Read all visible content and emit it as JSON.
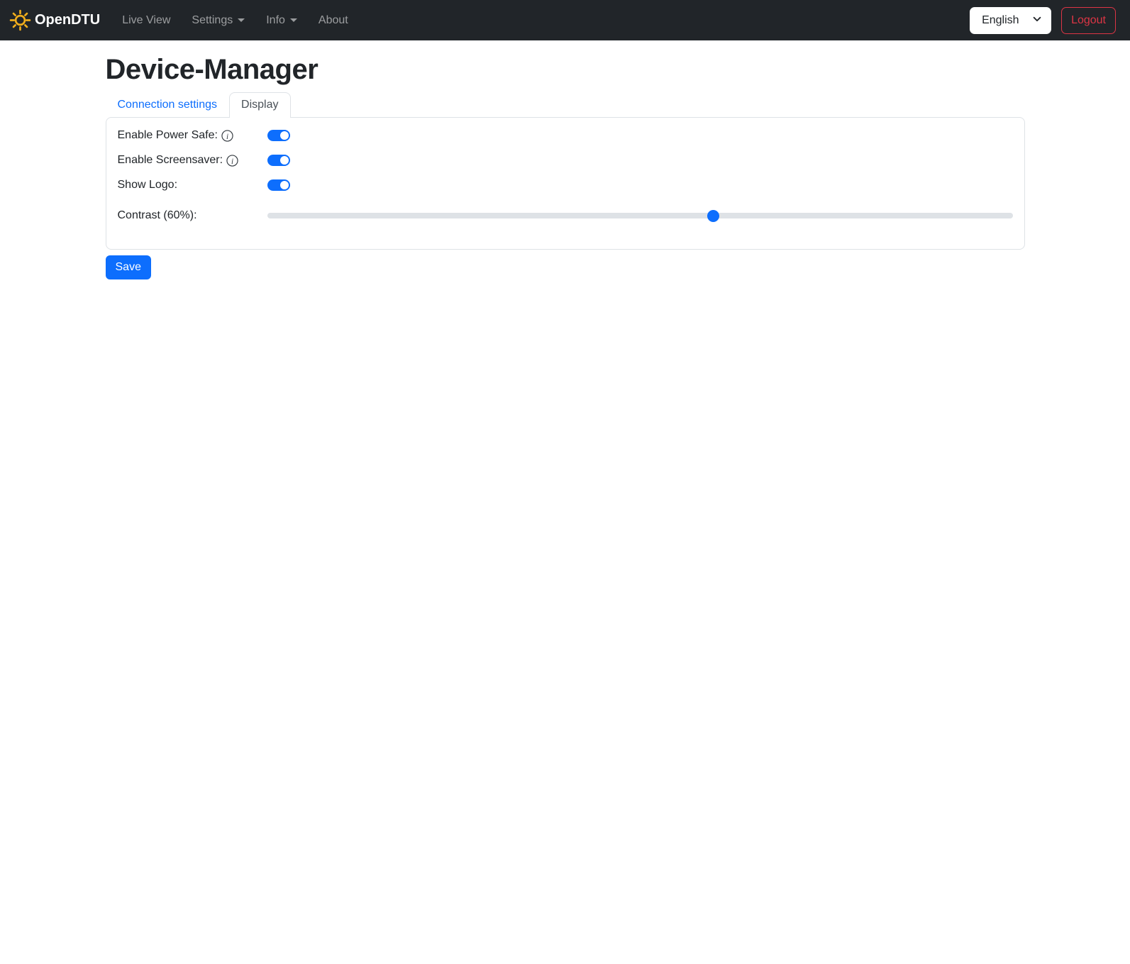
{
  "navbar": {
    "brand": "OpenDTU",
    "items": [
      {
        "label": "Live View",
        "dropdown": false
      },
      {
        "label": "Settings",
        "dropdown": true
      },
      {
        "label": "Info",
        "dropdown": true
      },
      {
        "label": "About",
        "dropdown": false
      }
    ],
    "language_selected": "English",
    "logout_label": "Logout"
  },
  "page": {
    "title": "Device-Manager"
  },
  "tabs": [
    {
      "label": "Connection settings",
      "active": false
    },
    {
      "label": "Display",
      "active": true
    }
  ],
  "form": {
    "fields": [
      {
        "label": "Enable Power Safe:",
        "type": "switch",
        "value": "on",
        "has_info": true
      },
      {
        "label": "Enable Screensaver:",
        "type": "switch",
        "value": "on",
        "has_info": true
      },
      {
        "label": "Show Logo:",
        "type": "switch",
        "value": "on",
        "has_info": false
      },
      {
        "label": "Contrast (60%):",
        "type": "range",
        "value": 60,
        "min": 0,
        "max": 100
      }
    ],
    "save_label": "Save"
  },
  "colors": {
    "accent": "#0d6efd",
    "danger": "#dc3545",
    "navbar_bg": "#212529",
    "sun_gold": "#f0ad1c",
    "border": "#dee2e6"
  }
}
